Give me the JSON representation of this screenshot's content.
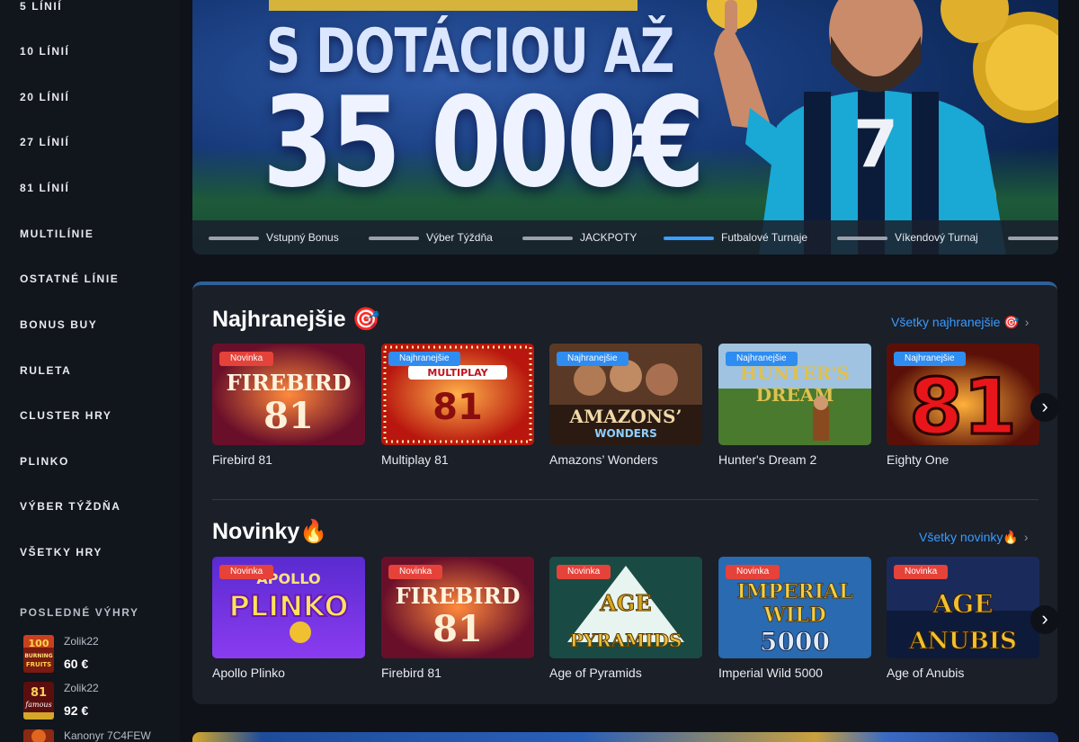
{
  "sidebar": {
    "items": [
      {
        "label": "5 LÍNIÍ"
      },
      {
        "label": "10 LÍNIÍ"
      },
      {
        "label": "20 LÍNIÍ"
      },
      {
        "label": "27 LÍNIÍ"
      },
      {
        "label": "81 LÍNIÍ"
      },
      {
        "label": "MULTILÍNIE"
      },
      {
        "label": "OSTATNÉ LÍNIE"
      },
      {
        "label": "BONUS BUY"
      },
      {
        "label": "RULETA"
      },
      {
        "label": "CLUSTER HRY"
      },
      {
        "label": "PLINKO"
      },
      {
        "label": "VÝBER TÝŽDŇA"
      },
      {
        "label": "VŠETKY HRY"
      }
    ],
    "recent_wins_title": "POSLEDNÉ VÝHRY",
    "recent_wins": [
      {
        "user": "Zolik22",
        "amount": "60 €",
        "thumb_icon": "100-burning-fruits-thumb"
      },
      {
        "user": "Zolik22",
        "amount": "92 €",
        "thumb_icon": "81-famous-lines-thumb"
      },
      {
        "user": "Kanonyr 7C4FEW",
        "amount": "",
        "thumb_icon": "game-thumb"
      }
    ]
  },
  "hero": {
    "line1": "S DOTÁCIOU AŽ",
    "line2": "35 000€",
    "tabs": [
      {
        "label": "Vstupný Bonus",
        "active": false
      },
      {
        "label": "Výber Týždňa",
        "active": false
      },
      {
        "label": "JACKPOTY",
        "active": false
      },
      {
        "label": "Futbalové Turnaje",
        "active": true
      },
      {
        "label": "Víkendový Turnaj",
        "active": false
      }
    ]
  },
  "sections": {
    "popular": {
      "title": "Najhranejšie 🎯",
      "see_all": "Všetky najhranejšie 🎯",
      "games": [
        {
          "name": "Firebird 81",
          "badge": "Novinka",
          "badge_color": "#e5423a",
          "art": "FIREBIRD 81"
        },
        {
          "name": "Multiplay 81",
          "badge": "Najhranejšie",
          "badge_color": "#2f8cf0",
          "art": "MULTIPLAY 81"
        },
        {
          "name": "Amazons’ Wonders",
          "badge": "Najhranejšie",
          "badge_color": "#2f8cf0",
          "art": "AMAZONS’ WONDERS"
        },
        {
          "name": "Hunter's Dream 2",
          "badge": "Najhranejšie",
          "badge_color": "#2f8cf0",
          "art": "HUNTER'S DREAM"
        },
        {
          "name": "Eighty One",
          "badge": "Najhranejšie",
          "badge_color": "#2f8cf0",
          "art": "81"
        }
      ]
    },
    "new": {
      "title": "Novinky🔥",
      "see_all": "Všetky novinky🔥",
      "games": [
        {
          "name": "Apollo Plinko",
          "badge": "Novinka",
          "badge_color": "#e5423a",
          "art": "APOLLO PLINKO"
        },
        {
          "name": "Firebird 81",
          "badge": "Novinka",
          "badge_color": "#e5423a",
          "art": "FIREBIRD 81"
        },
        {
          "name": "Age of Pyramids",
          "badge": "Novinka",
          "badge_color": "#e5423a",
          "art": "AGE OF PYRAMIDS"
        },
        {
          "name": "Imperial Wild 5000",
          "badge": "Novinka",
          "badge_color": "#e5423a",
          "art": "IMPERIAL WILD 5000"
        },
        {
          "name": "Age of Anubis",
          "badge": "Novinka",
          "badge_color": "#e5423a",
          "art": "AGE OF ANUBIS"
        }
      ]
    }
  },
  "colors": {
    "accent": "#3a9bff",
    "badge_new": "#e5423a",
    "badge_popular": "#2f8cf0",
    "panel_bg": "#1a1f28"
  }
}
